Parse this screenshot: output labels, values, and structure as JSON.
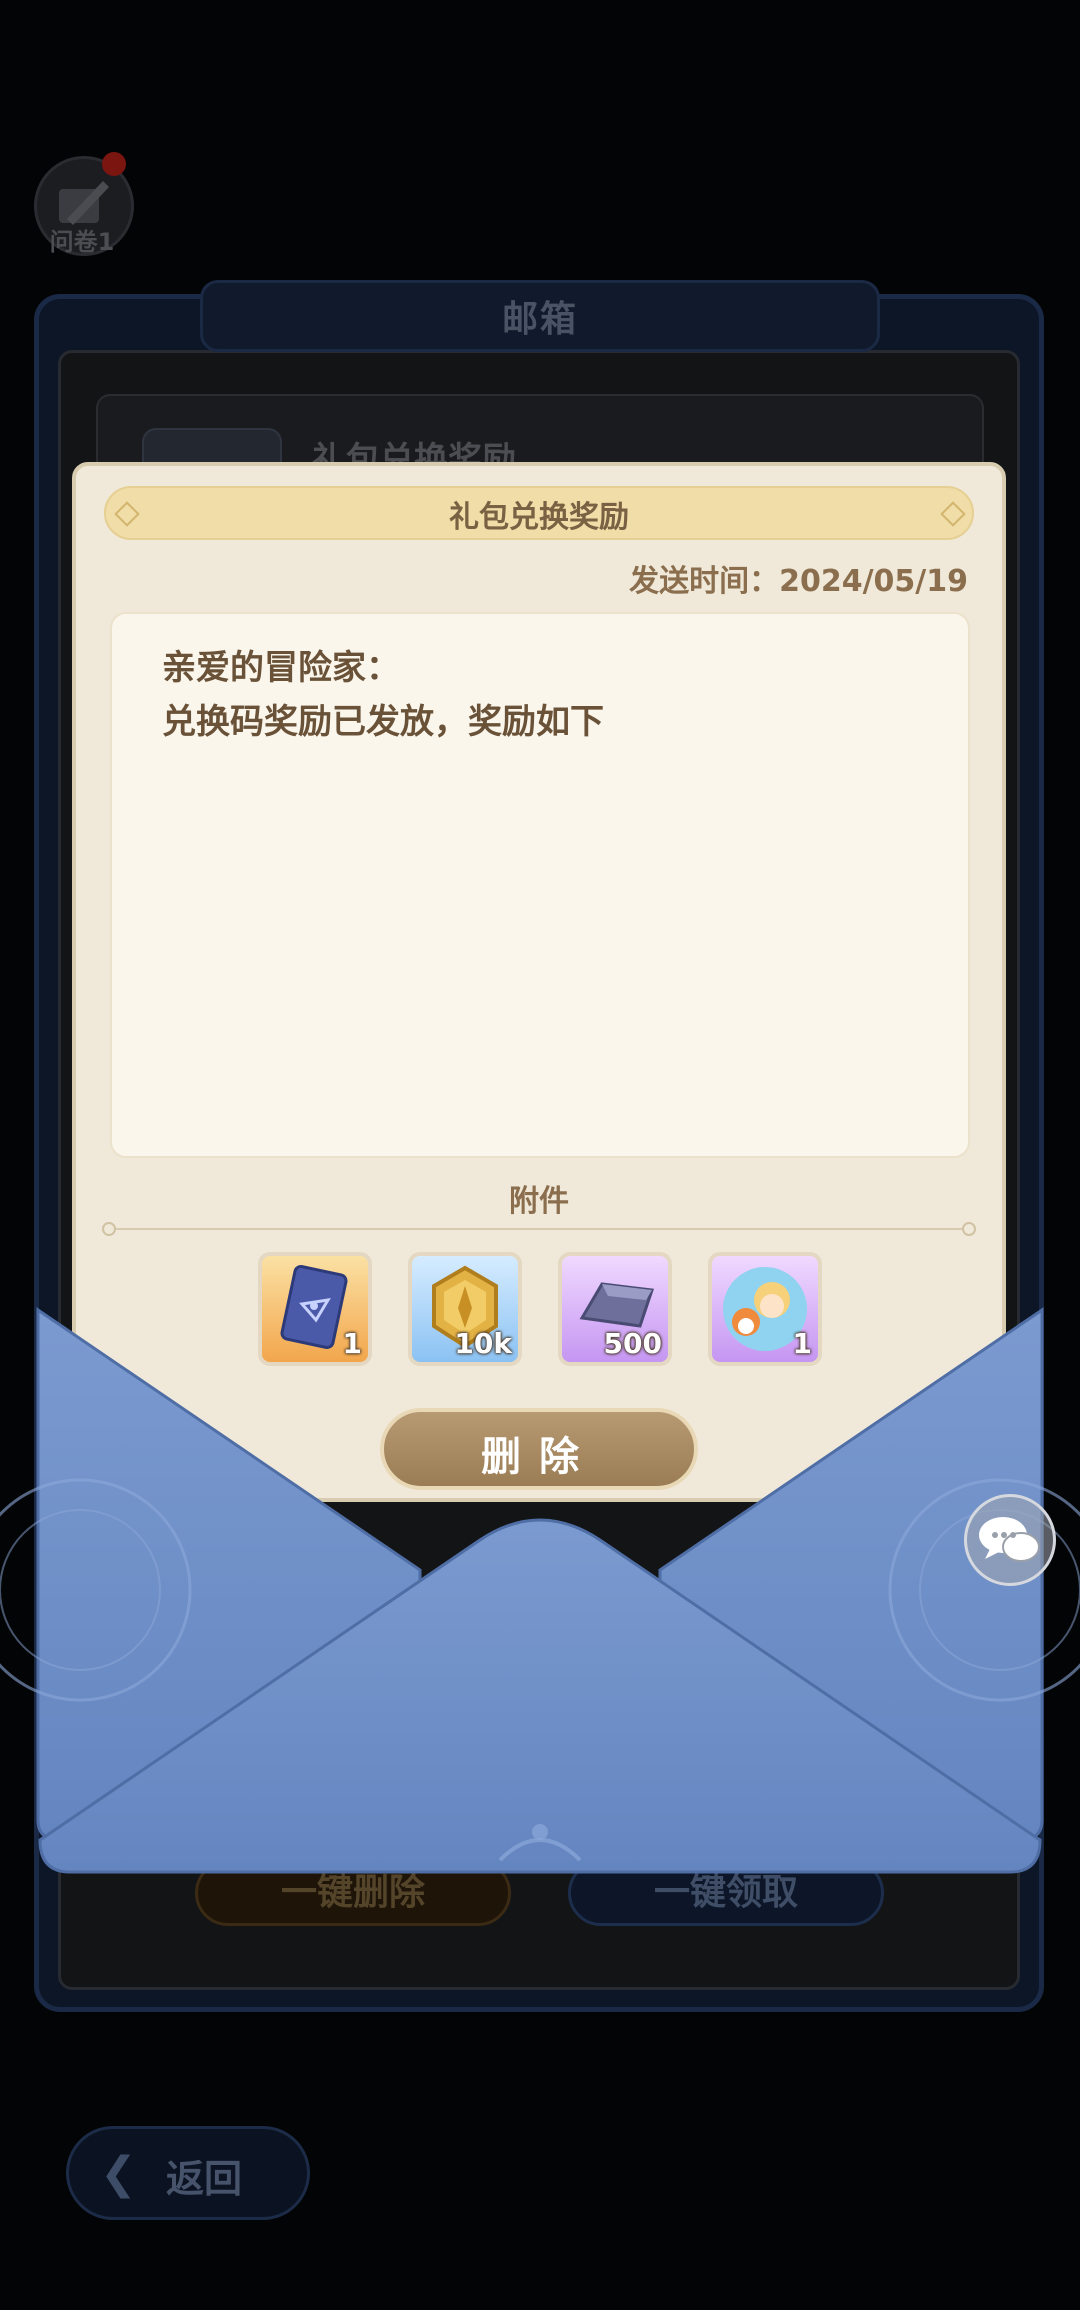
{
  "survey": {
    "label": "问卷1",
    "icon": "survey-quill-icon",
    "has_notification": true
  },
  "mailbox": {
    "title": "邮箱",
    "list": [
      {
        "title": "礼包兑换奖励"
      }
    ],
    "delete_all_label": "一键删除",
    "claim_all_label": "一键领取"
  },
  "back": {
    "label": "返回",
    "icon": "back-arrow-icon"
  },
  "letter": {
    "title": "礼包兑换奖励",
    "send_time": "发送时间：2024/05/19",
    "greeting": "亲爱的冒险家：",
    "message": "兑换码奖励已发放，奖励如下",
    "attachments_title": "附件",
    "attachments": [
      {
        "icon": "card-ticket-icon",
        "qty": "1"
      },
      {
        "icon": "gold-coin-icon",
        "qty": "10k"
      },
      {
        "icon": "silver-ingot-icon",
        "qty": "500"
      },
      {
        "icon": "character-avatar-icon",
        "qty": "1"
      }
    ],
    "delete_label": "删除"
  },
  "chat": {
    "icon": "chat-bubble-icon"
  },
  "colors": {
    "envelope": "#6f8fc7",
    "paper": "#f0e9d9",
    "title_bar": "#f0dda7",
    "button": "#a88b62"
  }
}
